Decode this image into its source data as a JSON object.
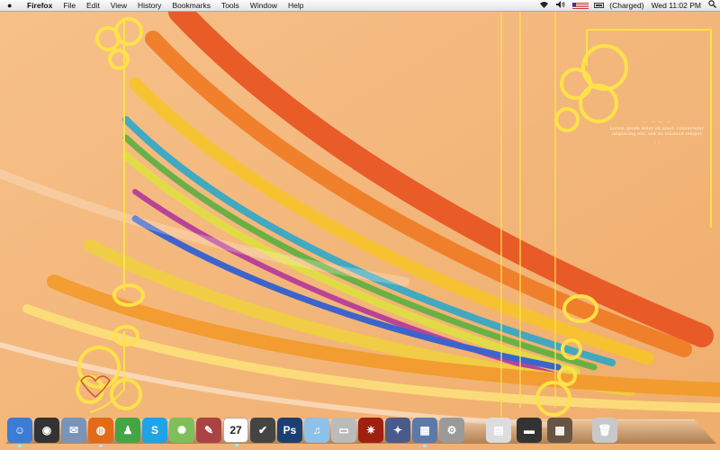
{
  "menubar": {
    "app_name": "Firefox",
    "menus": [
      "File",
      "Edit",
      "View",
      "History",
      "Bookmarks",
      "Tools",
      "Window",
      "Help"
    ],
    "battery_status": "(Charged)",
    "clock": "Wed 11:02 PM"
  },
  "dock": {
    "apps": [
      {
        "name": "finder-icon",
        "color": "#3c7bd6",
        "glyph": "☺"
      },
      {
        "name": "dashboard-icon",
        "color": "#333333",
        "glyph": "◉"
      },
      {
        "name": "mail-icon",
        "color": "#7a93b8",
        "glyph": "✉"
      },
      {
        "name": "firefox-icon",
        "color": "#e36b17",
        "glyph": "◍"
      },
      {
        "name": "ichat-icon",
        "color": "#44a544",
        "glyph": "♟"
      },
      {
        "name": "skype-icon",
        "color": "#1fa3e6",
        "glyph": "S"
      },
      {
        "name": "safari-icon",
        "color": "#7fbf5a",
        "glyph": "✺"
      },
      {
        "name": "address-book-icon",
        "color": "#a44",
        "glyph": "✎"
      },
      {
        "name": "ical-icon",
        "color": "#ffffff",
        "glyph": "27"
      },
      {
        "name": "notes-icon",
        "color": "#444",
        "glyph": "✔"
      },
      {
        "name": "photoshop-icon",
        "color": "#1c3f73",
        "glyph": "Ps"
      },
      {
        "name": "itunes-icon",
        "color": "#8ec1e8",
        "glyph": "♫"
      },
      {
        "name": "disk-utility-icon",
        "color": "#bbb",
        "glyph": "▭"
      },
      {
        "name": "photo-booth-icon",
        "color": "#a02010",
        "glyph": "✷"
      },
      {
        "name": "front-row-icon",
        "color": "#4a5a8a",
        "glyph": "✦"
      },
      {
        "name": "spaces-icon",
        "color": "#5b7aa8",
        "glyph": "▦"
      },
      {
        "name": "system-preferences-icon",
        "color": "#9a9a9a",
        "glyph": "⚙"
      }
    ],
    "docs": [
      {
        "name": "document-stack-icon",
        "color": "#ddd",
        "glyph": "▤"
      },
      {
        "name": "minimized-window-icon",
        "color": "#333",
        "glyph": "▬"
      },
      {
        "name": "minimized-window-photo-icon",
        "color": "#665544",
        "glyph": "▩"
      },
      {
        "name": "trash-icon",
        "color": "#c8c8c8",
        "glyph": "🗑"
      }
    ]
  },
  "wallpaper": {
    "title": "~ ~ ~ ~",
    "text": "Lorem ipsum dolor sit amet, consectetur adipiscing elit, sed do eiusmod tempor",
    "signature": "– –"
  }
}
